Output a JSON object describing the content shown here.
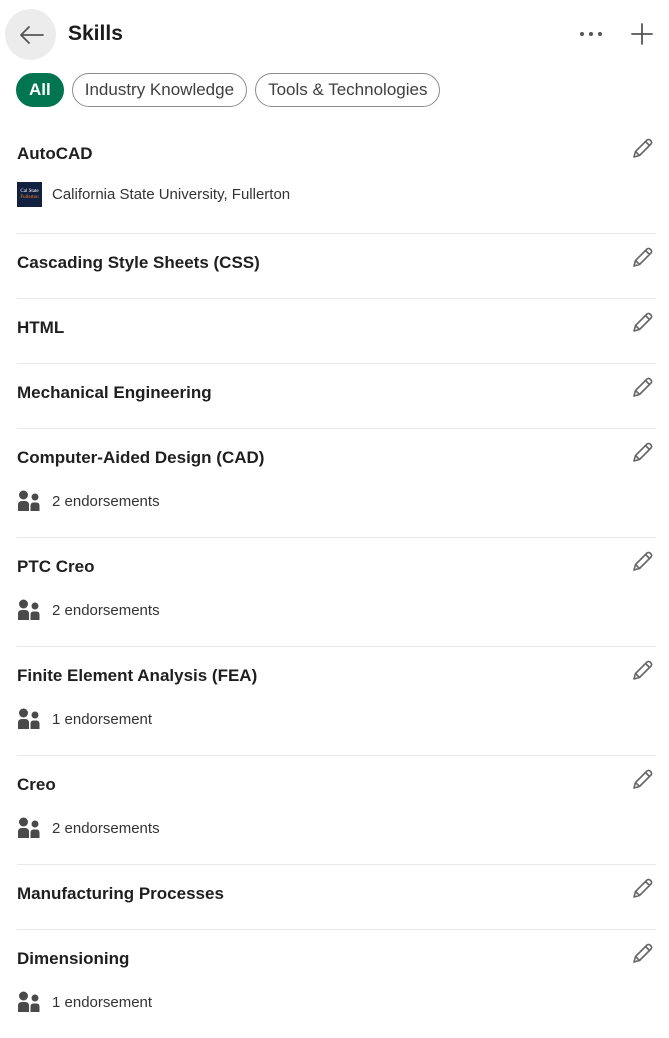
{
  "header": {
    "title": "Skills",
    "back_icon": "arrow-left-icon",
    "more_icon": "more-horizontal-icon",
    "add_icon": "plus-icon"
  },
  "filters": [
    {
      "label": "All",
      "active": true
    },
    {
      "label": "Industry Knowledge",
      "active": false
    },
    {
      "label": "Tools & Technologies",
      "active": false
    }
  ],
  "colors": {
    "accent": "#01754f",
    "text": "#191919",
    "divider": "#e8e8e8",
    "logo_bg": "#12213f"
  },
  "skills": [
    {
      "name": "AutoCAD",
      "sub_type": "institution",
      "sub_text": "California State University, Fullerton",
      "logo_text": [
        "Cal State",
        "Fullerton"
      ]
    },
    {
      "name": "Cascading Style Sheets (CSS)"
    },
    {
      "name": "HTML"
    },
    {
      "name": "Mechanical Engineering"
    },
    {
      "name": "Computer-Aided Design (CAD)",
      "sub_type": "endorsement",
      "sub_text": "2 endorsements"
    },
    {
      "name": "PTC Creo",
      "sub_type": "endorsement",
      "sub_text": "2 endorsements"
    },
    {
      "name": "Finite Element Analysis (FEA)",
      "sub_type": "endorsement",
      "sub_text": "1 endorsement"
    },
    {
      "name": "Creo",
      "sub_type": "endorsement",
      "sub_text": "2 endorsements"
    },
    {
      "name": "Manufacturing Processes"
    },
    {
      "name": "Dimensioning",
      "sub_type": "endorsement",
      "sub_text": "1 endorsement"
    }
  ]
}
